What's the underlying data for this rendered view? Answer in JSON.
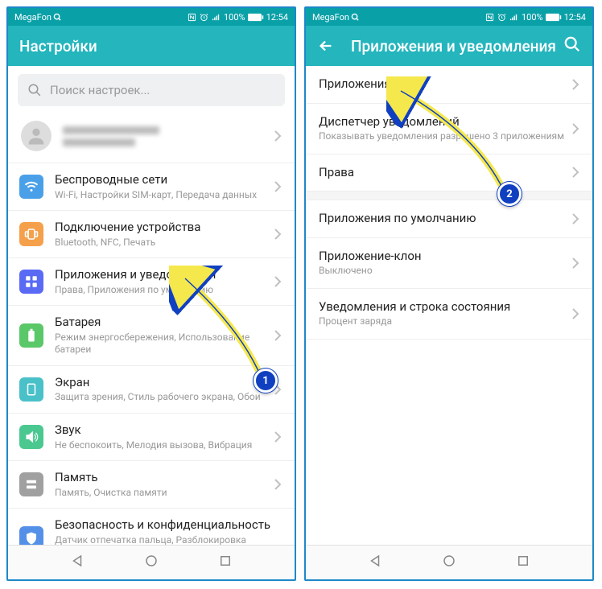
{
  "status": {
    "carrier": "MegaFon",
    "battery": "100%",
    "time": "12:54"
  },
  "left": {
    "title": "Настройки",
    "search_placeholder": "Поиск настроек...",
    "items": [
      {
        "title": "Беспроводные сети",
        "sub": "Wi-Fi, Настройки SIM-карт, Передача данных"
      },
      {
        "title": "Подключение устройства",
        "sub": "Bluetooth, NFC, Печать"
      },
      {
        "title": "Приложения и уведомления",
        "sub": "Права, Приложения по умолчанию"
      },
      {
        "title": "Батарея",
        "sub": "Режим энергосбережения, Использование батареи"
      },
      {
        "title": "Экран",
        "sub": "Защита зрения, Стиль рабочего экрана, Обои"
      },
      {
        "title": "Звук",
        "sub": "Не беспокоить, Мелодия вызова, Вибрация"
      },
      {
        "title": "Память",
        "sub": "Память, Очистка памяти"
      },
      {
        "title": "Безопасность и конфиденциальность",
        "sub": "Датчик отпечатка пальца, Разблокировка распознаванием лица, Блокировка экрана"
      }
    ]
  },
  "right": {
    "title": "Приложения и уведомления",
    "items": [
      {
        "title": "Приложения",
        "sub": ""
      },
      {
        "title": "Диспетчер уведомлений",
        "sub": "Показывать уведомления разрешено 3 приложениям"
      },
      {
        "title": "Права",
        "sub": ""
      },
      {
        "title": "Приложения по умолчанию",
        "sub": ""
      },
      {
        "title": "Приложение-клон",
        "sub": "Выключено"
      },
      {
        "title": "Уведомления и строка состояния",
        "sub": "Процент заряда"
      }
    ]
  },
  "markers": {
    "m1": "1",
    "m2": "2"
  }
}
